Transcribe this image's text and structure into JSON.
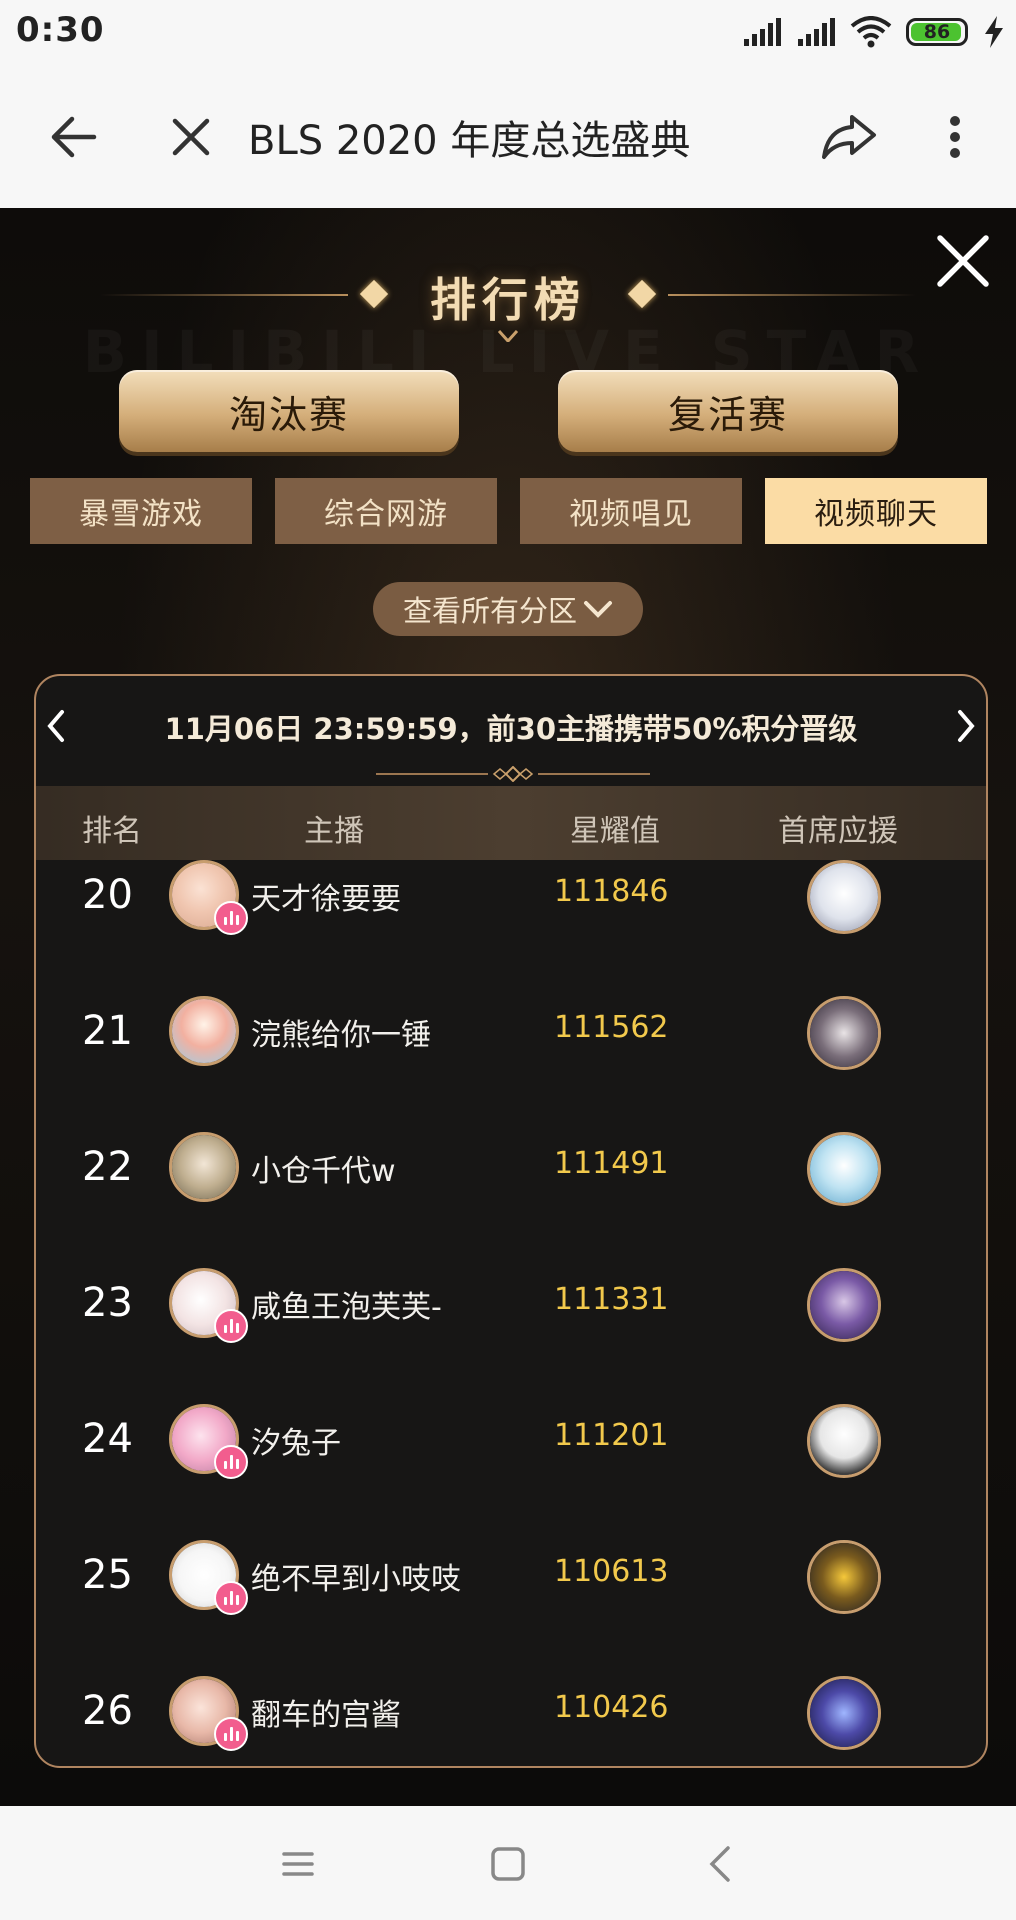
{
  "status_bar": {
    "time": "0:30",
    "battery_level": "86",
    "icons": [
      "signal-icon",
      "signal-icon",
      "wifi-icon",
      "battery-icon",
      "charging-icon"
    ]
  },
  "browser": {
    "title": "BLS 2020 年度总选盛典",
    "icons": [
      "back-arrow-icon",
      "close-icon",
      "share-icon",
      "more-vert-icon"
    ]
  },
  "panel": {
    "board_title": "排行榜",
    "watermark": "BILIBILI LIVE STAR",
    "phase_buttons": [
      "淘汰赛",
      "复活赛"
    ],
    "category_tabs": [
      {
        "label": "暴雪游戏",
        "active": false
      },
      {
        "label": "综合网游",
        "active": false
      },
      {
        "label": "视频唱见",
        "active": false
      },
      {
        "label": "视频聊天",
        "active": true
      }
    ],
    "all_zones_label": "查看所有分区",
    "notice": "11月06日 23:59:59，前30主播携带50%积分晋级",
    "table_headers": {
      "rank": "排名",
      "streamer": "主播",
      "score": "星耀值",
      "top_supporter": "首席应援"
    },
    "rows": [
      {
        "rank": "20",
        "name": "天才徐要要",
        "score": "111846",
        "live": true
      },
      {
        "rank": "21",
        "name": "浣熊给你一锤",
        "score": "111562",
        "live": false
      },
      {
        "rank": "22",
        "name": "小仓千代w",
        "score": "111491",
        "live": false
      },
      {
        "rank": "23",
        "name": "咸鱼王泡芙芙-",
        "score": "111331",
        "live": true
      },
      {
        "rank": "24",
        "name": "汐兔子",
        "score": "111201",
        "live": true
      },
      {
        "rank": "25",
        "name": "绝不早到小吱吱",
        "score": "110613",
        "live": true
      },
      {
        "rank": "26",
        "name": "翻车的宫酱",
        "score": "110426",
        "live": true
      }
    ]
  },
  "colors": {
    "accent_gold": "#fbdca5",
    "score_yellow": "#f2c94c",
    "tab_brown": "#7e5f45",
    "live_pink": "#f25d8e"
  },
  "bottom_nav": {
    "icons": [
      "menu-icon",
      "home-square-icon",
      "back-chevron-icon"
    ]
  }
}
